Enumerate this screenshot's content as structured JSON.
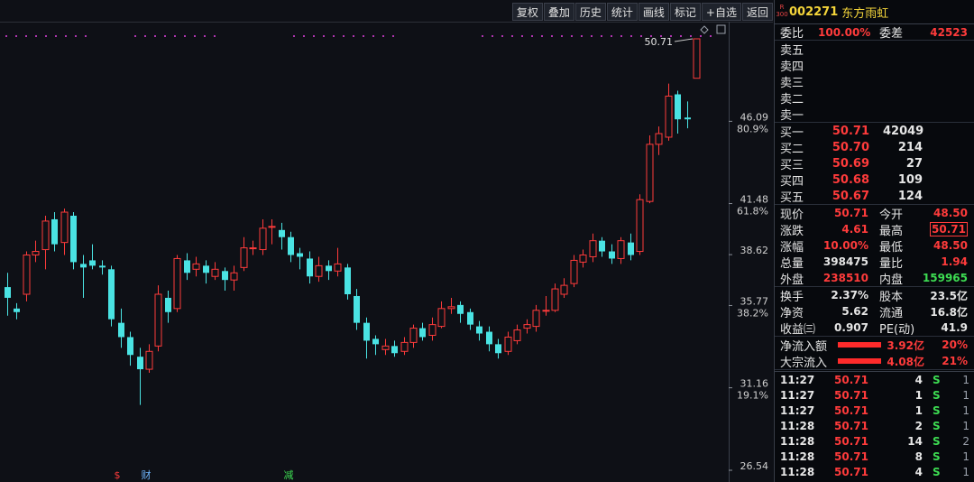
{
  "toolbar": {
    "buttons": [
      "复权",
      "叠加",
      "历史",
      "统计",
      "画线",
      "标记",
      "+自选",
      "返回"
    ]
  },
  "chart": {
    "high_label": "50.71",
    "price_axis": [
      {
        "price": "46.09",
        "pct": "80.9%"
      },
      {
        "price": "41.48",
        "pct": "61.8%"
      },
      {
        "price": "38.62",
        "pct": ""
      },
      {
        "price": "35.77",
        "pct": "38.2%"
      },
      {
        "price": "31.16",
        "pct": "19.1%"
      },
      {
        "price": "26.54",
        "pct": ""
      }
    ],
    "event_markers": [
      {
        "text": "$",
        "color": "#ff3b3b"
      },
      {
        "text": "财",
        "color": "#6fb6ff"
      },
      {
        "text": "减",
        "color": "#3ddc52"
      }
    ],
    "colors": {
      "up": "#ff3b3b",
      "down": "#4ae3e3",
      "grid": "#2c3038",
      "dots": "#e040e0"
    }
  },
  "chart_data": {
    "type": "candlestick",
    "ylim": [
      26.54,
      50.71
    ],
    "candles": [
      [
        36.8,
        36.2,
        37.6,
        35.2
      ],
      [
        35.6,
        35.4,
        35.9,
        35.0
      ],
      [
        36.4,
        38.6,
        38.8,
        36.0
      ],
      [
        38.6,
        38.8,
        39.4,
        38.2
      ],
      [
        38.9,
        40.5,
        40.8,
        37.8
      ],
      [
        40.6,
        39.2,
        41.0,
        38.8
      ],
      [
        39.3,
        41.0,
        41.2,
        38.6
      ],
      [
        40.8,
        38.2,
        41.0,
        37.8
      ],
      [
        38.1,
        37.9,
        38.6,
        36.2
      ],
      [
        38.3,
        38.0,
        39.2,
        37.8
      ],
      [
        38.0,
        37.9,
        38.3,
        37.5
      ],
      [
        37.8,
        35.0,
        38.0,
        34.6
      ],
      [
        34.8,
        34.0,
        35.6,
        33.4
      ],
      [
        34.0,
        33.0,
        34.3,
        32.4
      ],
      [
        32.9,
        32.2,
        33.4,
        30.2
      ],
      [
        32.2,
        33.2,
        33.6,
        32.0
      ],
      [
        33.5,
        36.4,
        36.9,
        33.2
      ],
      [
        36.2,
        35.4,
        36.6,
        34.8
      ],
      [
        35.6,
        38.4,
        38.6,
        35.4
      ],
      [
        38.3,
        37.6,
        38.7,
        37.2
      ],
      [
        37.8,
        38.1,
        38.5,
        37.4
      ],
      [
        38.0,
        37.6,
        38.3,
        37.0
      ],
      [
        37.4,
        37.8,
        38.2,
        37.2
      ],
      [
        37.7,
        37.2,
        37.9,
        36.6
      ],
      [
        37.2,
        37.6,
        38.0,
        36.6
      ],
      [
        37.9,
        39.0,
        39.6,
        37.7
      ],
      [
        39.0,
        39.0,
        39.4,
        38.6
      ],
      [
        38.9,
        40.1,
        40.6,
        38.6
      ],
      [
        40.2,
        40.2,
        40.6,
        39.2
      ],
      [
        40.0,
        39.6,
        40.4,
        38.9
      ],
      [
        39.6,
        38.6,
        39.9,
        38.2
      ],
      [
        38.7,
        38.5,
        39.0,
        37.8
      ],
      [
        38.4,
        37.4,
        38.8,
        37.0
      ],
      [
        37.4,
        38.0,
        38.5,
        37.1
      ],
      [
        38.0,
        37.7,
        38.3,
        37.2
      ],
      [
        37.7,
        38.1,
        39.0,
        37.4
      ],
      [
        37.9,
        36.4,
        38.1,
        36.1
      ],
      [
        36.3,
        34.8,
        36.7,
        34.4
      ],
      [
        34.8,
        33.8,
        35.1,
        32.8
      ],
      [
        33.9,
        33.6,
        34.1,
        33.0
      ],
      [
        33.3,
        33.5,
        33.9,
        33.0
      ],
      [
        33.5,
        33.1,
        33.8,
        32.9
      ],
      [
        33.2,
        33.7,
        34.0,
        33.0
      ],
      [
        33.7,
        34.5,
        34.7,
        33.4
      ],
      [
        34.5,
        34.0,
        34.8,
        33.8
      ],
      [
        34.1,
        34.7,
        35.1,
        33.8
      ],
      [
        34.6,
        35.6,
        36.0,
        34.5
      ],
      [
        35.6,
        35.7,
        36.2,
        35.3
      ],
      [
        35.8,
        35.3,
        36.0,
        34.8
      ],
      [
        35.4,
        34.7,
        35.6,
        34.4
      ],
      [
        34.6,
        34.2,
        34.9,
        33.8
      ],
      [
        34.3,
        33.6,
        34.6,
        33.2
      ],
      [
        33.6,
        33.1,
        33.9,
        32.8
      ],
      [
        33.2,
        34.0,
        34.3,
        33.0
      ],
      [
        33.8,
        34.4,
        34.7,
        33.6
      ],
      [
        34.5,
        34.7,
        35.0,
        34.2
      ],
      [
        34.6,
        35.5,
        35.8,
        34.3
      ],
      [
        35.5,
        35.5,
        36.3,
        35.2
      ],
      [
        35.5,
        36.7,
        37.0,
        35.4
      ],
      [
        36.4,
        36.9,
        37.3,
        36.2
      ],
      [
        37.0,
        38.3,
        38.6,
        36.8
      ],
      [
        38.2,
        38.6,
        38.9,
        37.9
      ],
      [
        38.5,
        39.4,
        39.8,
        38.2
      ],
      [
        39.4,
        38.8,
        39.6,
        38.5
      ],
      [
        38.8,
        38.4,
        39.2,
        38.1
      ],
      [
        38.4,
        39.4,
        39.6,
        38.1
      ],
      [
        39.3,
        38.6,
        39.8,
        38.3
      ],
      [
        38.8,
        41.7,
        42.0,
        38.6
      ],
      [
        41.6,
        44.8,
        45.3,
        41.5
      ],
      [
        44.8,
        45.4,
        45.8,
        44.2
      ],
      [
        45.2,
        47.5,
        48.2,
        45.0
      ],
      [
        47.6,
        46.2,
        47.8,
        45.4
      ],
      [
        46.3,
        46.2,
        47.2,
        45.7
      ],
      [
        48.5,
        50.71,
        50.71,
        48.5
      ]
    ]
  },
  "quote": {
    "r_badge": "R\n300",
    "code": "002271",
    "name": "东方雨虹",
    "committee": {
      "ratio_label": "委比",
      "ratio": "100.00%",
      "diff_label": "委差",
      "diff": "42523"
    },
    "asks": [
      {
        "label": "卖五",
        "price": "",
        "vol": ""
      },
      {
        "label": "卖四",
        "price": "",
        "vol": ""
      },
      {
        "label": "卖三",
        "price": "",
        "vol": ""
      },
      {
        "label": "卖二",
        "price": "",
        "vol": ""
      },
      {
        "label": "卖一",
        "price": "",
        "vol": ""
      }
    ],
    "bids": [
      {
        "label": "买一",
        "price": "50.71",
        "vol": "42049"
      },
      {
        "label": "买二",
        "price": "50.70",
        "vol": "214"
      },
      {
        "label": "买三",
        "price": "50.69",
        "vol": "27"
      },
      {
        "label": "买四",
        "price": "50.68",
        "vol": "109"
      },
      {
        "label": "买五",
        "price": "50.67",
        "vol": "124"
      }
    ],
    "stats1": [
      {
        "l1": "现价",
        "v1": "50.71",
        "c1": "red",
        "l2": "今开",
        "v2": "48.50",
        "c2": "red"
      },
      {
        "l1": "涨跌",
        "v1": "4.61",
        "c1": "red",
        "l2": "最高",
        "v2": "50.71",
        "c2": "red"
      },
      {
        "l1": "涨幅",
        "v1": "10.00%",
        "c1": "red",
        "l2": "最低",
        "v2": "48.50",
        "c2": "red"
      },
      {
        "l1": "总量",
        "v1": "398475",
        "c1": "wht",
        "l2": "量比",
        "v2": "1.94",
        "c2": "red"
      },
      {
        "l1": "外盘",
        "v1": "238510",
        "c1": "red",
        "l2": "内盘",
        "v2": "159965",
        "c2": "grn"
      }
    ],
    "stats2": [
      {
        "l1": "换手",
        "v1": "2.37%",
        "l2": "股本",
        "v2": "23.5亿"
      },
      {
        "l1": "净资",
        "v1": "5.62",
        "l2": "流通",
        "v2": "16.8亿"
      },
      {
        "l1": "收益㈢",
        "v1": "0.907",
        "l2": "PE(动)",
        "v2": "41.9"
      }
    ],
    "flows": [
      {
        "label": "净流入额",
        "value": "3.92亿",
        "pct": "20%"
      },
      {
        "label": "大宗流入",
        "value": "4.08亿",
        "pct": "21%"
      }
    ],
    "ticks": [
      {
        "time": "11:27",
        "price": "50.71",
        "vol": "4",
        "side": "S",
        "n": "1"
      },
      {
        "time": "11:27",
        "price": "50.71",
        "vol": "1",
        "side": "S",
        "n": "1"
      },
      {
        "time": "11:27",
        "price": "50.71",
        "vol": "1",
        "side": "S",
        "n": "1"
      },
      {
        "time": "11:28",
        "price": "50.71",
        "vol": "2",
        "side": "S",
        "n": "1"
      },
      {
        "time": "11:28",
        "price": "50.71",
        "vol": "14",
        "side": "S",
        "n": "2"
      },
      {
        "time": "11:28",
        "price": "50.71",
        "vol": "8",
        "side": "S",
        "n": "1"
      },
      {
        "time": "11:28",
        "price": "50.71",
        "vol": "4",
        "side": "S",
        "n": "1"
      }
    ]
  }
}
